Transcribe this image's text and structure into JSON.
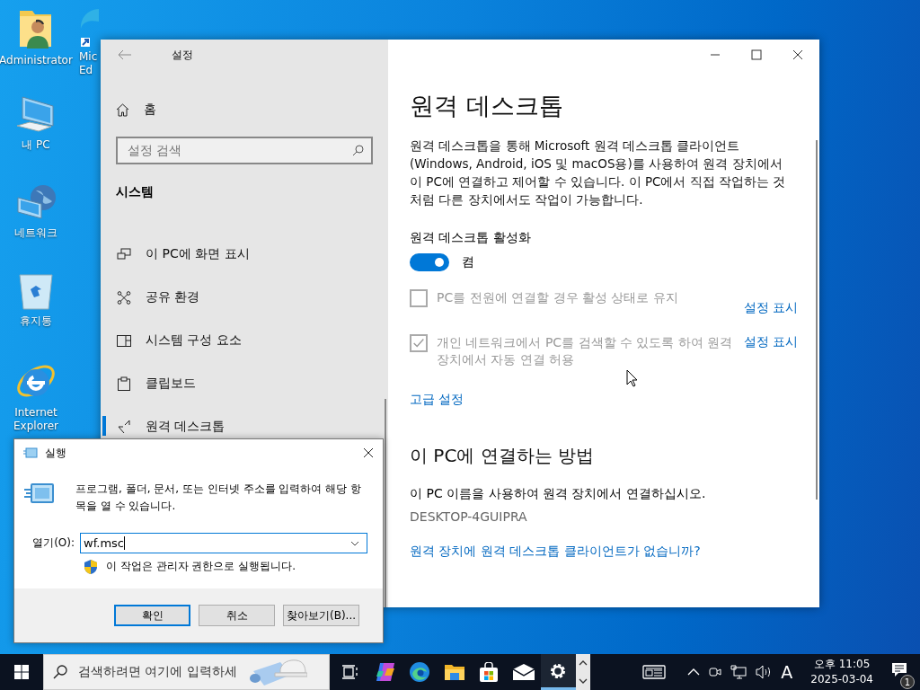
{
  "desktop_icons": [
    {
      "kind": "user-folder",
      "lines": [
        "Administrator"
      ]
    },
    {
      "kind": "computer",
      "lines": [
        "내 PC"
      ]
    },
    {
      "kind": "network",
      "lines": [
        "네트워크"
      ]
    },
    {
      "kind": "recycle-bin",
      "lines": [
        "휴지통"
      ]
    },
    {
      "kind": "ie",
      "lines": [
        "Internet",
        "Explorer"
      ]
    },
    {
      "kind": "edge",
      "lines": [
        "Mic",
        "Ed"
      ]
    }
  ],
  "settings": {
    "title": "설정",
    "nav": {
      "home": "홈",
      "search_placeholder": "설정 검색",
      "section": "시스템",
      "items": [
        {
          "kind": "display",
          "label": "이 PC에 화면 표시",
          "selected": false
        },
        {
          "kind": "share",
          "label": "공유 환경",
          "selected": false
        },
        {
          "kind": "components",
          "label": "시스템 구성 요소",
          "selected": false
        },
        {
          "kind": "clipboard",
          "label": "클립보드",
          "selected": false
        },
        {
          "kind": "remote",
          "label": "원격 데스크톱",
          "selected": true
        }
      ]
    },
    "content": {
      "title": "원격 데스크톱",
      "description": "원격 데스크톱을 통해 Microsoft 원격 데스크톱 클라이언트 (Windows, Android, iOS 및 macOS용)를 사용하여 원격 장치에서 이 PC에 연결하고 제어할 수 있습니다. 이 PC에서 직접 작업하는 것처럼 다른 장치에서도 작업이 가능합니다.",
      "toggle_label": "원격 데스크톱 활성화",
      "toggle": {
        "on": true,
        "state_text": "켬"
      },
      "options": [
        {
          "label": "PC를 전원에 연결할 경우 활성 상태로 유지",
          "checked": false,
          "disabled": true,
          "link": "설정 표시"
        },
        {
          "label": "개인 네트워크에서 PC를 검색할 수 있도록 하여 원격 장치에서 자동 연결 허용",
          "checked": true,
          "disabled": true,
          "link": "설정 표시"
        }
      ],
      "advanced_link": "고급 설정",
      "connect": {
        "heading": "이 PC에 연결하는 방법",
        "text": "이 PC 이름을 사용하여 원격 장치에서 연결하십시오.",
        "pc_name": "DESKTOP-4GUIPRA",
        "link": "원격 장치에 원격 데스크톱 클라이언트가 없습니까?"
      }
    }
  },
  "run_dialog": {
    "title": "실행",
    "description": "프로그램, 폴더, 문서, 또는 인터넷 주소를 입력하여 해당 항목을 열 수 있습니다.",
    "open_label": "열기(O):",
    "value": "wf.msc",
    "admin_note": "이 작업은 관리자 권한으로 실행됩니다.",
    "buttons": [
      {
        "label": "확인",
        "default": true
      },
      {
        "label": "취소",
        "default": false
      },
      {
        "label": "찾아보기(B)...",
        "default": false
      }
    ]
  },
  "taskbar": {
    "search_placeholder": "검색하려면 여기에 입력하세",
    "apps": [
      {
        "kind": "task-view",
        "active": false
      },
      {
        "kind": "copilot",
        "active": false
      },
      {
        "kind": "edge",
        "active": false
      },
      {
        "kind": "explorer",
        "active": false
      },
      {
        "kind": "store",
        "active": false
      },
      {
        "kind": "mail",
        "active": false
      },
      {
        "kind": "settings",
        "active": true
      }
    ],
    "ime": "A",
    "time": "오후 11:05",
    "date": "2025-03-04",
    "notifications": "1"
  }
}
